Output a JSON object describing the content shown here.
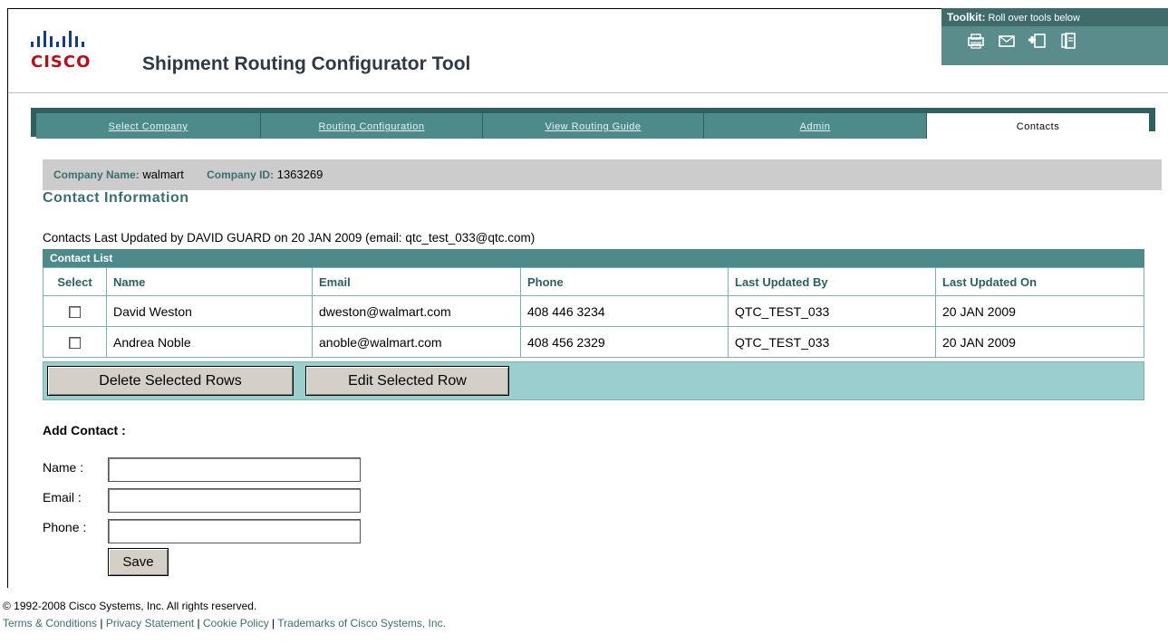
{
  "header": {
    "logo_text": "CISCO",
    "title": "Shipment Routing Configurator Tool"
  },
  "toolkit": {
    "label": "Toolkit:",
    "hint": "Roll over tools below",
    "icons": [
      "print-icon",
      "email-icon",
      "add-bookmark-icon",
      "document-icon"
    ]
  },
  "tabs": [
    {
      "label": "Select Company",
      "active": false
    },
    {
      "label": "Routing Configuration",
      "active": false
    },
    {
      "label": "View Routing Guide",
      "active": false
    },
    {
      "label": "Admin",
      "active": false
    },
    {
      "label": "Contacts",
      "active": true
    }
  ],
  "company": {
    "name_label": "Company Name:",
    "name_value": "walmart",
    "id_label": "Company ID:",
    "id_value": "1363269"
  },
  "section_title": "Contact Information",
  "last_updated": "Contacts Last Updated by DAVID GUARD on 20 JAN 2009 (email: qtc_test_033@qtc.com)",
  "contact_list": {
    "title": "Contact List",
    "columns": [
      "Select",
      "Name",
      "Email",
      "Phone",
      "Last Updated By",
      "Last Updated On"
    ],
    "rows": [
      {
        "name": "David Weston",
        "email": "dweston@walmart.com",
        "phone": "408 446 3234",
        "updated_by": "QTC_TEST_033",
        "updated_on": "20 JAN 2009"
      },
      {
        "name": "Andrea Noble",
        "email": "anoble@walmart.com",
        "phone": "408 456 2329",
        "updated_by": "QTC_TEST_033",
        "updated_on": "20 JAN 2009"
      }
    ],
    "delete_label": "Delete Selected Rows",
    "edit_label": "Edit Selected Row"
  },
  "add_contact": {
    "title": "Add Contact :",
    "name_label": "Name :",
    "email_label": "Email :",
    "phone_label": "Phone :",
    "name_value": "",
    "email_value": "",
    "phone_value": "",
    "save_label": "Save"
  },
  "footer": {
    "copyright": "© 1992-2008 Cisco Systems, Inc. All rights reserved.",
    "links": [
      "Terms & Conditions",
      "Privacy Statement",
      "Cookie Policy",
      "Trademarks of Cisco Systems, Inc."
    ]
  }
}
